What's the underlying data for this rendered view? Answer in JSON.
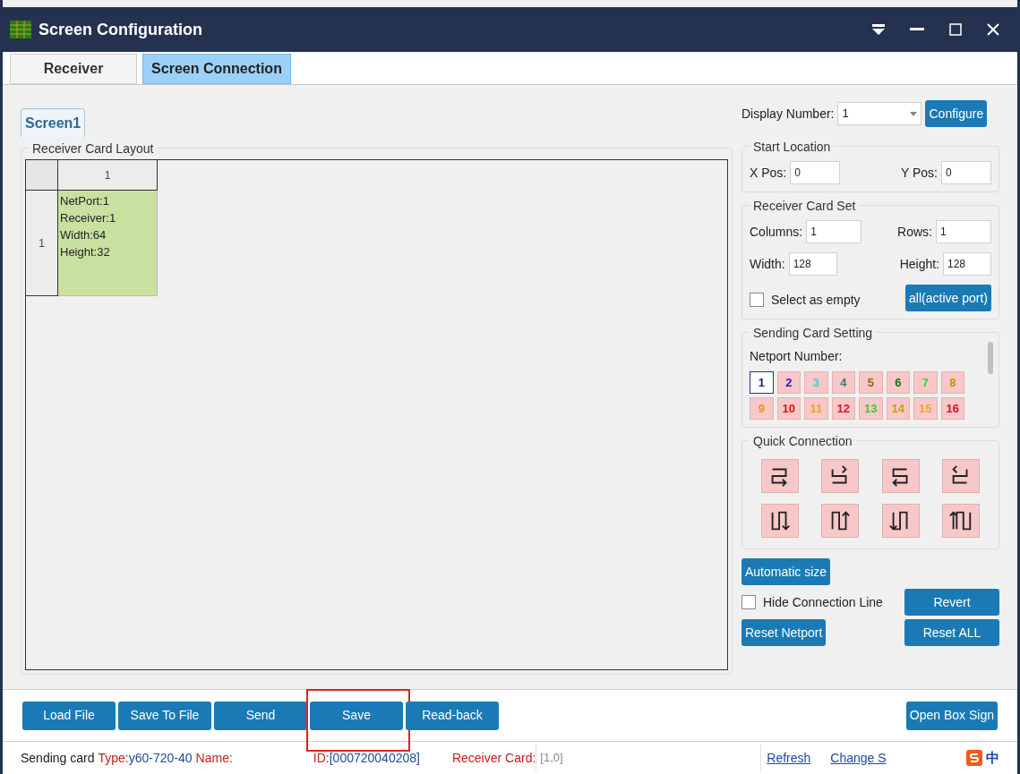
{
  "window": {
    "title": "Screen Configuration"
  },
  "tabs": [
    {
      "label": "Receiver",
      "selected": false
    },
    {
      "label": "Screen Connection",
      "selected": true
    }
  ],
  "screen_tabs": [
    {
      "label": "Screen1",
      "selected": true
    }
  ],
  "layout": {
    "title": "Receiver Card Layout",
    "column_headers": [
      "1"
    ],
    "rows": [
      {
        "header": "1",
        "cards": [
          {
            "lines": [
              "NetPort:1",
              "Receiver:1",
              "Width:64",
              "Height:32"
            ]
          }
        ]
      }
    ]
  },
  "display": {
    "label": "Display Number:",
    "value": "1",
    "button": "Configure"
  },
  "start_location": {
    "title": "Start Location",
    "fields": [
      {
        "label": "X Pos:",
        "value": "0"
      },
      {
        "label": "Y Pos:",
        "value": "0"
      }
    ]
  },
  "card_set": {
    "title": "Receiver Card Set",
    "fields": [
      {
        "label": "Columns:",
        "value": "1"
      },
      {
        "label": "Rows:",
        "value": "1"
      },
      {
        "label": "Width:",
        "value": "128"
      },
      {
        "label": "Height:",
        "value": "128"
      }
    ],
    "checkbox": {
      "label": "Select as empty",
      "checked": false
    },
    "button": "all(active port)"
  },
  "sending": {
    "title": "Sending Card Setting",
    "label": "Netport Number:",
    "ports": [
      {
        "label": "1",
        "color": "#1a1a80",
        "selected": true
      },
      {
        "label": "2",
        "color": "#2020d0",
        "selected": false
      },
      {
        "label": "3",
        "color": "#40d0d0",
        "selected": false
      },
      {
        "label": "4",
        "color": "#3a7a70",
        "selected": false
      },
      {
        "label": "5",
        "color": "#8a6a10",
        "selected": false
      },
      {
        "label": "6",
        "color": "#1a6a1a",
        "selected": false
      },
      {
        "label": "7",
        "color": "#40d040",
        "selected": false
      },
      {
        "label": "8",
        "color": "#c89000",
        "selected": false
      },
      {
        "label": "9",
        "color": "#f09020",
        "selected": false
      },
      {
        "label": "10",
        "color": "#e01010",
        "selected": false
      },
      {
        "label": "11",
        "color": "#f0a020",
        "selected": false
      },
      {
        "label": "12",
        "color": "#e01030",
        "selected": false
      },
      {
        "label": "13",
        "color": "#30d030",
        "selected": false
      },
      {
        "label": "14",
        "color": "#c8a000",
        "selected": false
      },
      {
        "label": "15",
        "color": "#f0a040",
        "selected": false
      },
      {
        "label": "16",
        "color": "#d01020",
        "selected": false
      }
    ]
  },
  "quick": {
    "title": "Quick Connection",
    "patterns": [
      {
        "kind": "rr"
      },
      {
        "kind": "lr"
      },
      {
        "kind": "rl"
      },
      {
        "kind": "ll"
      },
      {
        "kind": "ud"
      },
      {
        "kind": "du"
      },
      {
        "kind": "dd"
      },
      {
        "kind": "uu"
      }
    ]
  },
  "controls": {
    "auto_button": "Automatic size",
    "hide_line": {
      "label": "Hide Connection Line",
      "checked": false
    },
    "revert": "Revert",
    "reset_netport": "Reset Netport",
    "reset_all": "Reset ALL"
  },
  "actions": [
    {
      "label": "Load File",
      "highlighted": false
    },
    {
      "label": "Save To File",
      "highlighted": false
    },
    {
      "label": "Send",
      "highlighted": false
    },
    {
      "label": "Save",
      "highlighted": true
    },
    {
      "label": "Read-back",
      "highlighted": false
    }
  ],
  "open_box": "Open Box Sign",
  "status_bar": {
    "sending": "Sending card",
    "type_label": "Type:",
    "type_value": "y60-720-40",
    "name_label": "Name:",
    "id_label": "ID:",
    "id_value": "[000720040208]",
    "receiver_label": "Receiver Card:",
    "receiver_value": "[1,0]",
    "refresh": "Refresh",
    "change": "Change S",
    "ime": "中"
  }
}
